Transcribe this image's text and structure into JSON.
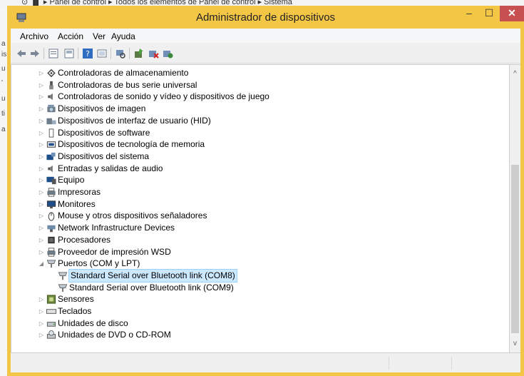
{
  "background_window": {
    "address": "⊙ ▐▌ ▸ Panel de control ▸ Todos los elementos de Panel de control ▸ Sistema",
    "side_letters": [
      "a",
      "is",
      "u",
      "'",
      "u",
      "ti",
      "a"
    ]
  },
  "window": {
    "title": "Administrador de dispositivos",
    "minimize": "–",
    "maximize": "☐",
    "close": "✕"
  },
  "menu": [
    "Archivo",
    "Acción",
    "Ver",
    "Ayuda"
  ],
  "toolbar_icons": [
    "back-icon",
    "forward-icon",
    "properties-view-icon",
    "list-view-icon",
    "help-icon",
    "show-hidden-icon",
    "scan-hardware-icon",
    "update-driver-icon",
    "uninstall-icon",
    "enable-device-icon"
  ],
  "tree": [
    {
      "label": "Controladoras de almacenamiento",
      "icon": "storage-controller-icon",
      "expanded": false
    },
    {
      "label": "Controladoras de bus serie universal",
      "icon": "usb-icon",
      "expanded": false
    },
    {
      "label": "Controladoras de sonido y vídeo y dispositivos de juego",
      "icon": "sound-icon",
      "expanded": false
    },
    {
      "label": "Dispositivos de imagen",
      "icon": "camera-icon",
      "expanded": false
    },
    {
      "label": "Dispositivos de interfaz de usuario (HID)",
      "icon": "hid-icon",
      "expanded": false
    },
    {
      "label": "Dispositivos de software",
      "icon": "software-device-icon",
      "expanded": false
    },
    {
      "label": "Dispositivos de tecnología de memoria",
      "icon": "memory-icon",
      "expanded": false
    },
    {
      "label": "Dispositivos del sistema",
      "icon": "system-device-icon",
      "expanded": false
    },
    {
      "label": "Entradas y salidas de audio",
      "icon": "audio-io-icon",
      "expanded": false
    },
    {
      "label": "Equipo",
      "icon": "computer-icon",
      "expanded": false
    },
    {
      "label": "Impresoras",
      "icon": "printer-icon",
      "expanded": false
    },
    {
      "label": "Monitores",
      "icon": "monitor-icon",
      "expanded": false
    },
    {
      "label": "Mouse y otros dispositivos señaladores",
      "icon": "mouse-icon",
      "expanded": false
    },
    {
      "label": "Network Infrastructure Devices",
      "icon": "network-device-icon",
      "expanded": false
    },
    {
      "label": "Procesadores",
      "icon": "processor-icon",
      "expanded": false
    },
    {
      "label": "Proveedor de impresión WSD",
      "icon": "wsd-printer-icon",
      "expanded": false
    },
    {
      "label": "Puertos (COM y LPT)",
      "icon": "port-icon",
      "expanded": true
    },
    {
      "label": "Standard Serial over Bluetooth link (COM8)",
      "icon": "port-icon",
      "child": true,
      "selected": true
    },
    {
      "label": "Standard Serial over Bluetooth link (COM9)",
      "icon": "port-icon",
      "child": true
    },
    {
      "label": "Sensores",
      "icon": "sensor-icon",
      "expanded": false
    },
    {
      "label": "Teclados",
      "icon": "keyboard-icon",
      "expanded": false
    },
    {
      "label": "Unidades de disco",
      "icon": "disk-drive-icon",
      "expanded": false
    },
    {
      "label": "Unidades de DVD o CD-ROM",
      "icon": "dvd-drive-icon",
      "expanded": false
    }
  ],
  "scroll": {
    "up": "^",
    "down": "v"
  },
  "colors": {
    "titlebar": "#f3c646",
    "close": "#c75050",
    "selection": "#cce8ff"
  }
}
